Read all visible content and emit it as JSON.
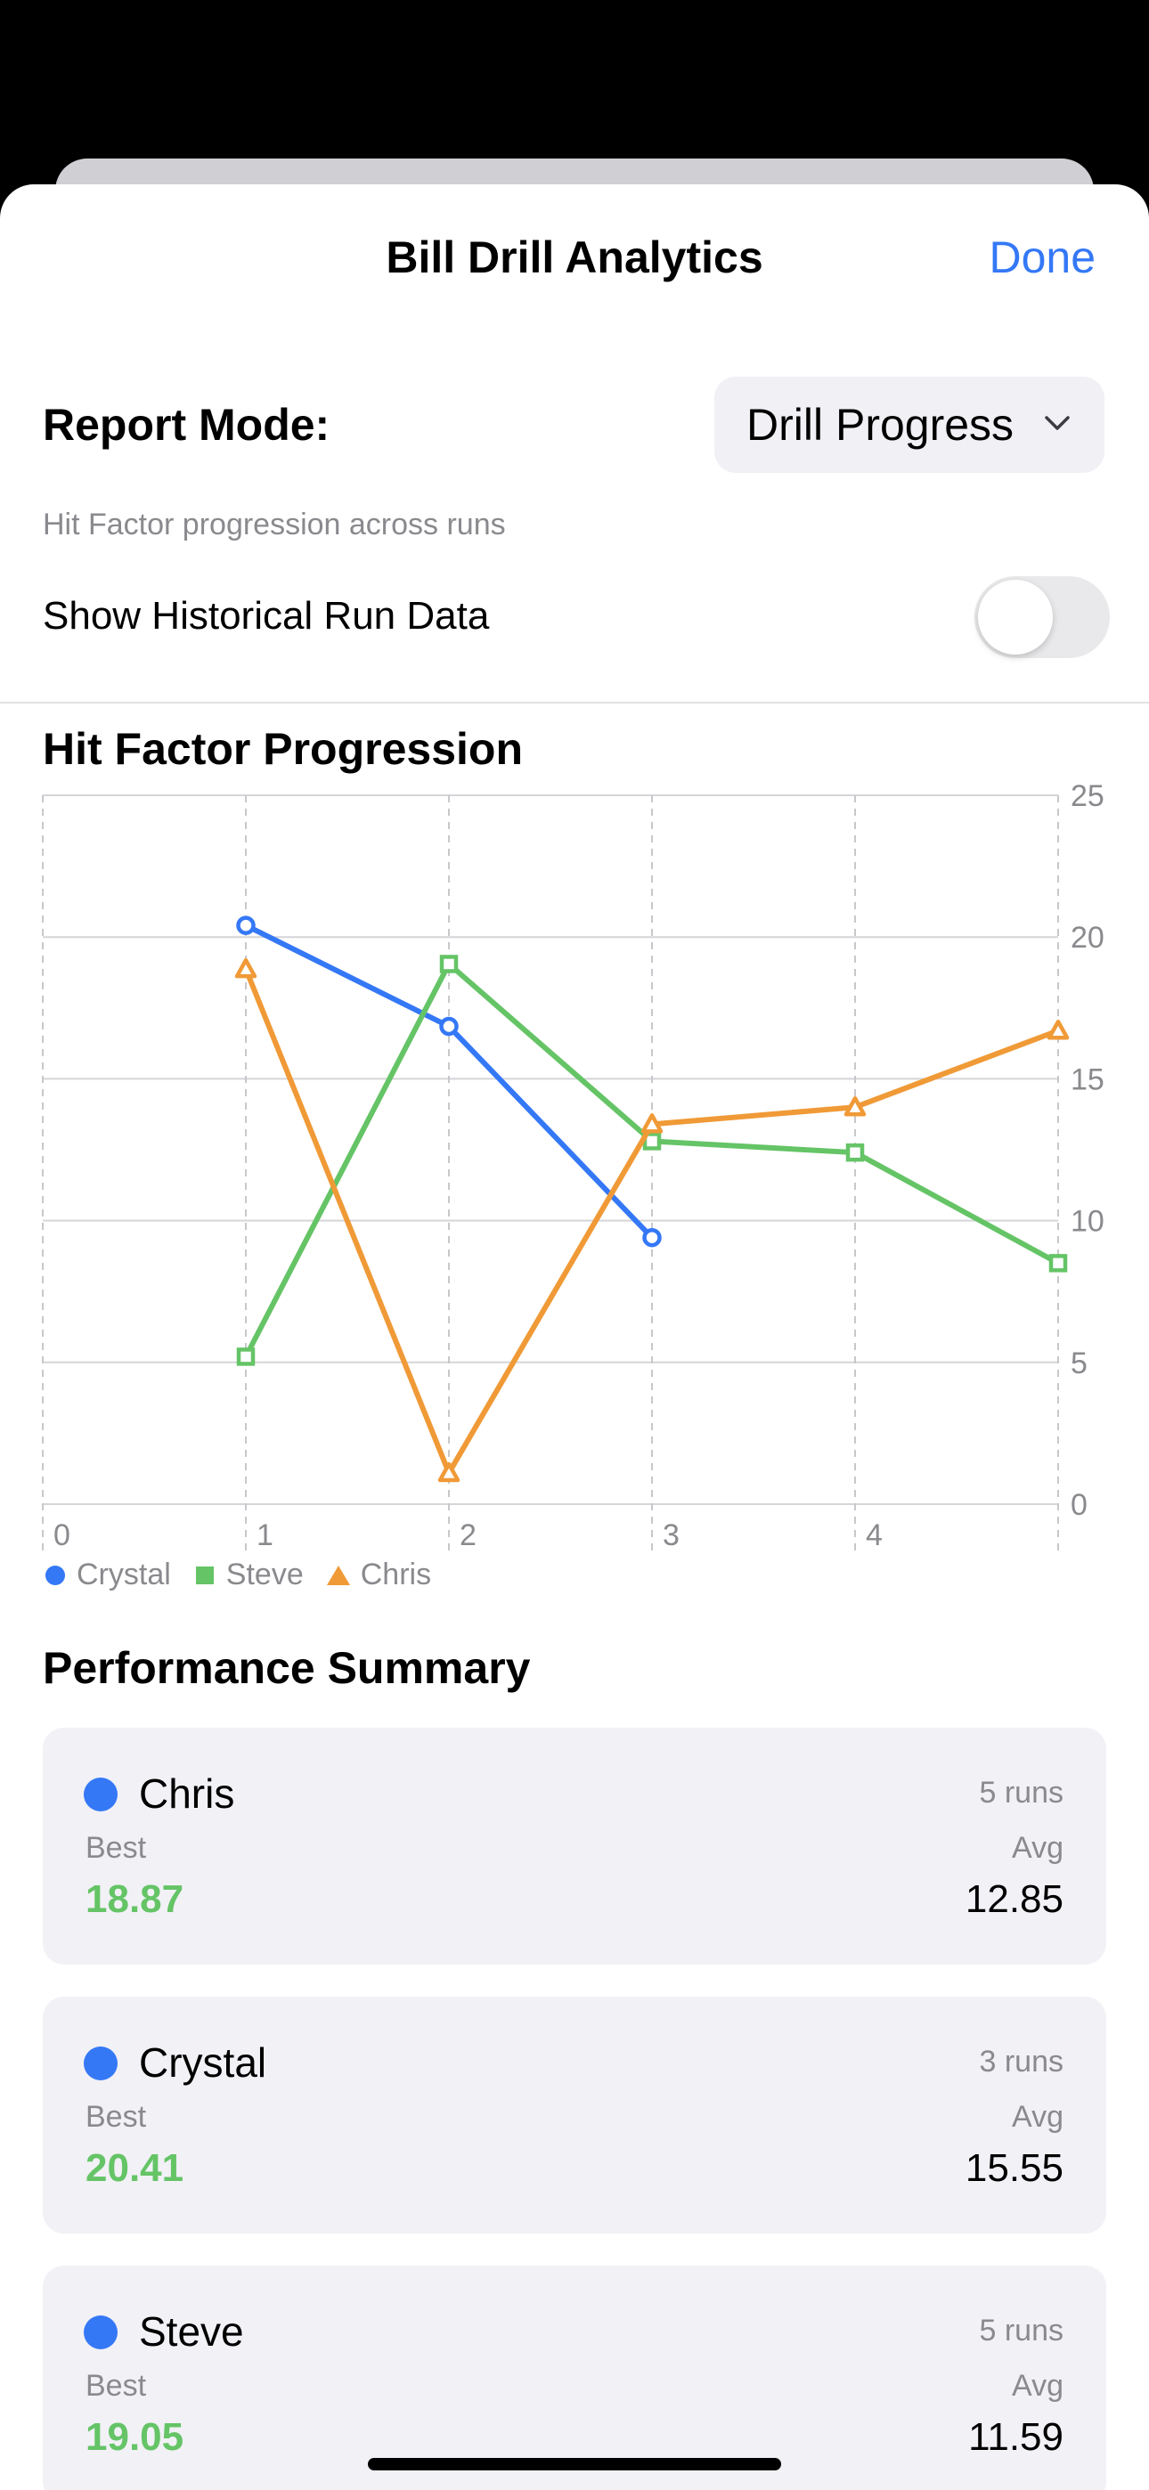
{
  "sheet": {
    "title": "Bill Drill Analytics",
    "done_label": "Done"
  },
  "report_mode": {
    "label": "Report Mode:",
    "selected": "Drill Progress",
    "description": "Hit Factor progression across runs"
  },
  "historical_toggle": {
    "label": "Show Historical Run Data",
    "on": false
  },
  "colors": {
    "accent": "#3478f6",
    "crystal": "#3478f6",
    "steve": "#65c466",
    "chris": "#f09a37",
    "best_value": "#65c466"
  },
  "chart_data": {
    "type": "line",
    "title": "Hit Factor Progression",
    "x_ticks": [
      "0",
      "1",
      "2",
      "3",
      "4"
    ],
    "y_ticks": [
      "0",
      "5",
      "10",
      "15",
      "20",
      "25"
    ],
    "xlim": [
      0,
      5
    ],
    "ylim": [
      0,
      25
    ],
    "y_axis_side": "right",
    "grid": true,
    "legend_position": "bottom-left",
    "series": [
      {
        "name": "Crystal",
        "marker": "circle",
        "color": "#3478f6",
        "x": [
          1,
          2,
          3
        ],
        "y": [
          20.41,
          16.85,
          9.4
        ]
      },
      {
        "name": "Steve",
        "marker": "square",
        "color": "#65c466",
        "x": [
          1,
          2,
          3,
          4,
          5
        ],
        "y": [
          5.2,
          19.05,
          12.8,
          12.4,
          8.5
        ]
      },
      {
        "name": "Chris",
        "marker": "triangle",
        "color": "#f09a37",
        "x": [
          1,
          2,
          3,
          4,
          5
        ],
        "y": [
          18.87,
          1.1,
          13.4,
          14.0,
          16.7
        ]
      }
    ]
  },
  "performance": {
    "title": "Performance Summary",
    "best_label": "Best",
    "avg_label": "Avg",
    "shooters": [
      {
        "name": "Chris",
        "runs": "5 runs",
        "best": "18.87",
        "avg": "12.85"
      },
      {
        "name": "Crystal",
        "runs": "3 runs",
        "best": "20.41",
        "avg": "15.55"
      },
      {
        "name": "Steve",
        "runs": "5 runs",
        "best": "19.05",
        "avg": "11.59"
      }
    ]
  }
}
